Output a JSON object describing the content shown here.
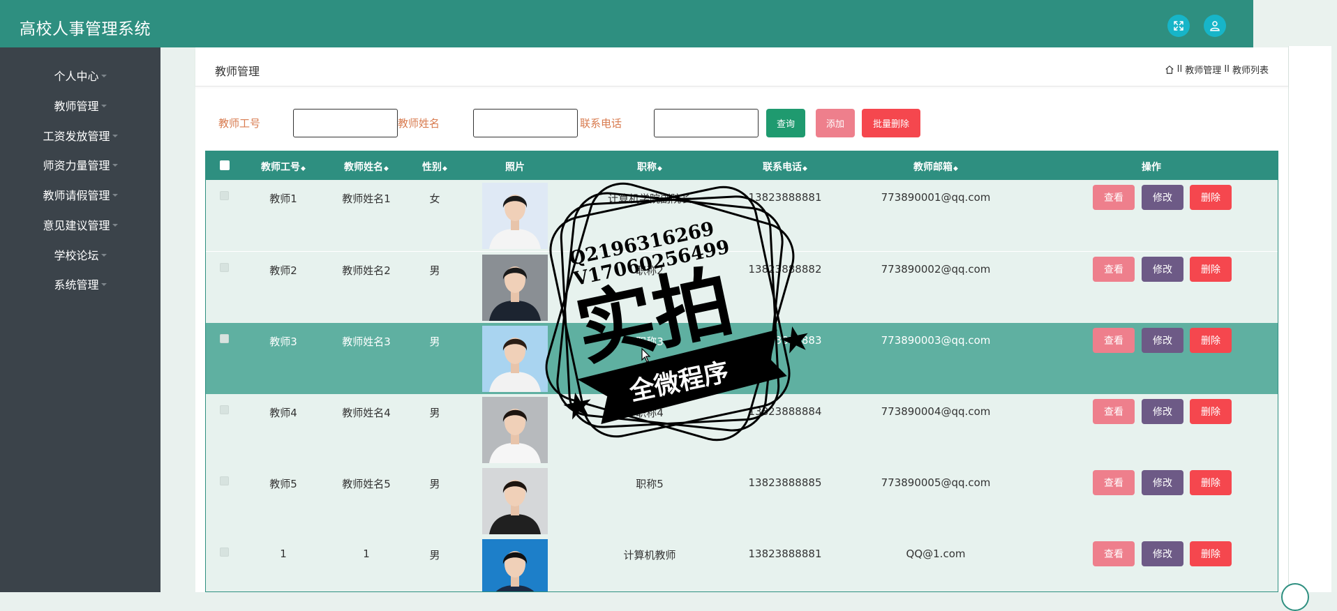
{
  "app": {
    "title": "高校人事管理系统"
  },
  "topbar": {
    "icons": [
      "fullscreen-icon",
      "user-icon"
    ]
  },
  "sidebar": {
    "items": [
      {
        "label": "个人中心"
      },
      {
        "label": "教师管理"
      },
      {
        "label": "工资发放管理"
      },
      {
        "label": "师资力量管理"
      },
      {
        "label": "教师请假管理"
      },
      {
        "label": "意见建议管理"
      },
      {
        "label": "学校论坛"
      },
      {
        "label": "系统管理"
      }
    ]
  },
  "breadcrumb": {
    "title": "教师管理",
    "sep": "II",
    "level1": "教师管理",
    "level2": "教师列表"
  },
  "search": {
    "teacher_no_label": "教师工号",
    "teacher_no_value": "",
    "teacher_name_label": "教师姓名",
    "teacher_name_value": "",
    "phone_label": "联系电话",
    "phone_value": "",
    "query_label": "查询",
    "add_label": "添加",
    "batch_delete_label": "批量删除"
  },
  "table": {
    "headers": {
      "no": "教师工号",
      "name": "教师姓名",
      "gender": "性别",
      "photo": "照片",
      "title": "职称",
      "phone": "联系电话",
      "email": "教师邮箱",
      "ops": "操作"
    },
    "sort_glyph": "◆",
    "actions": {
      "view": "查看",
      "edit": "修改",
      "delete": "删除"
    },
    "rows": [
      {
        "no": "教师1",
        "name": "教师姓名1",
        "gender": "女",
        "title": "计算机学院副院长",
        "phone": "13823888881",
        "email": "773890001@qq.com"
      },
      {
        "no": "教师2",
        "name": "教师姓名2",
        "gender": "男",
        "title": "职称2",
        "phone": "13823888882",
        "email": "773890002@qq.com"
      },
      {
        "no": "教师3",
        "name": "教师姓名3",
        "gender": "男",
        "title": "职称3",
        "phone": "13823888883",
        "email": "773890003@qq.com"
      },
      {
        "no": "教师4",
        "name": "教师姓名4",
        "gender": "男",
        "title": "职称4",
        "phone": "13823888884",
        "email": "773890004@qq.com"
      },
      {
        "no": "教师5",
        "name": "教师姓名5",
        "gender": "男",
        "title": "职称5",
        "phone": "13823888885",
        "email": "773890005@qq.com"
      },
      {
        "no": "1",
        "name": "1",
        "gender": "男",
        "title": "计算机教师",
        "phone": "13823888881",
        "email": "QQ@1.com"
      }
    ]
  },
  "watermark": {
    "line1": "Q2196316269",
    "line2": "V17060256499",
    "main": "实拍",
    "banner": "全微程序"
  },
  "colors": {
    "primary": "#2e8f80",
    "sidebar": "#3b434a",
    "query": "#1f9a6f",
    "add": "#ee7f8c",
    "delete": "#f5474e",
    "edit": "#6d5a86",
    "view": "#ee7f8c",
    "selected_row": "#5fb0a1"
  }
}
